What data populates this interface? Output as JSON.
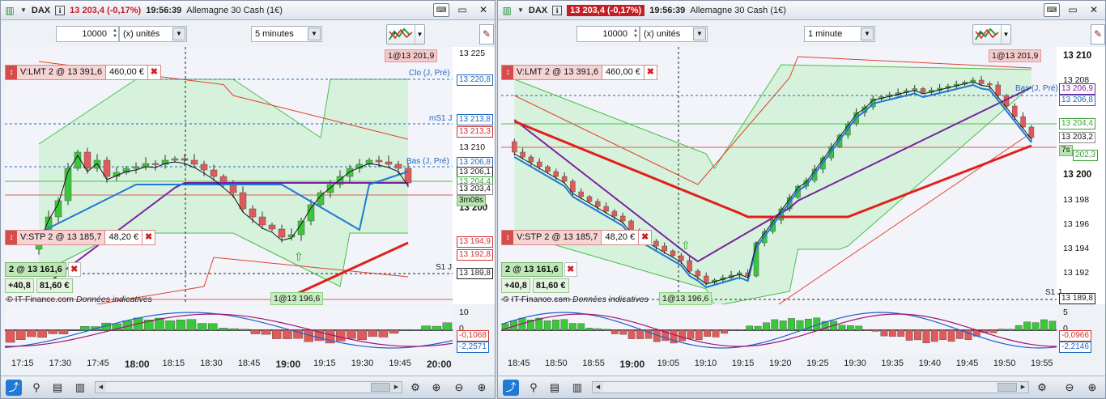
{
  "left": {
    "symbol": "DAX",
    "price": "13 203,4 (-0,17%)",
    "time": "19:56:39",
    "instrument": "Allemagne 30 Cash (1€)",
    "quantity": "10000",
    "unit": "(x) unités",
    "timeframe": "5 minutes",
    "yticks": [
      "13 225",
      "13 210",
      "13 200"
    ],
    "yboxes": {
      "clo": "13 220,8",
      "ms1": "13 213,8",
      "r": "13 213,3",
      "bas": "13 206,8",
      "v1": "13 206,1",
      "v2": "13 204,4",
      "last": "13 203,4",
      "timer": "3m08s",
      "stp": "13 194,9",
      "b2": "13 192,8",
      "s1": "13 189,8"
    },
    "levels": {
      "clo": "Clo (J, Pré)",
      "ms1": "mS1 J",
      "bas": "Bas (J, Pré)",
      "s1": "S1 J"
    },
    "order_lmt": {
      "label": "V:LMT  2 @ 13 391,6",
      "value": "460,00 €"
    },
    "order_stp": {
      "label": "V:STP  2 @ 13 185,7",
      "value": "48,20 €"
    },
    "position": {
      "label": "2 @ 13 161,6",
      "pnl_points": "+40,8",
      "pnl_value": "81,60 €"
    },
    "pill_top": "1@13 201,9",
    "pill_bottom": "1@13 196,6",
    "footer_brand": "IT-Finance.com",
    "footer_note": "Données indicatives",
    "xticks": [
      "17:15",
      "17:30",
      "17:45",
      "18:00",
      "18:15",
      "18:30",
      "18:45",
      "19:00",
      "19:15",
      "19:30",
      "19:45",
      "20:00"
    ],
    "ind_ticks": [
      "10",
      "0"
    ],
    "ind_vals": [
      "-0,1068",
      "-2,2571"
    ]
  },
  "right": {
    "symbol": "DAX",
    "price": "13 203,4 (-0,17%)",
    "time": "19:56:39",
    "instrument": "Allemagne 30 Cash (1€)",
    "quantity": "10000",
    "unit": "(x) unités",
    "timeframe": "1 minute",
    "yticks": [
      "13 210",
      "13 208",
      "13 200",
      "13 198",
      "13 196",
      "13 194",
      "13 192"
    ],
    "yboxes": {
      "bas": "13 206,9",
      "v1": "13 206,8",
      "v2": "13 204,4",
      "last": "13 203,2",
      "timer": "7s",
      "small": "202,3",
      "s1": "13 189,8"
    },
    "levels": {
      "bas": "Bas (J, Pré)",
      "s1": "S1 J"
    },
    "order_lmt": {
      "label": "V:LMT  2 @ 13 391,6",
      "value": "460,00 €"
    },
    "order_stp": {
      "label": "V:STP  2 @ 13 185,7",
      "value": "48,20 €"
    },
    "position": {
      "label": "2 @ 13 161,6",
      "pnl_points": "+40,8",
      "pnl_value": "81,60 €"
    },
    "pill_top": "1@13 201,9",
    "pill_bottom": "1@13 196,6",
    "footer_brand": "IT-Finance.com",
    "footer_note": "Données indicatives",
    "xticks": [
      "18:45",
      "18:50",
      "18:55",
      "19:00",
      "19:05",
      "19:10",
      "19:15",
      "19:20",
      "19:25",
      "19:30",
      "19:35",
      "19:40",
      "19:45",
      "19:50",
      "19:55"
    ],
    "ind_ticks": [
      "5",
      "0"
    ],
    "ind_vals": [
      "-0,0966",
      "-2,2146"
    ]
  },
  "icons": [
    "chart-icon",
    "info-icon",
    "keyboard-icon",
    "minimize-icon",
    "close-icon",
    "indicator-tool-icon",
    "pencil-icon",
    "share-icon",
    "tools-icon",
    "report-icon",
    "columns-icon",
    "zoom-fit-icon",
    "zoom-out-icon",
    "zoom-in-icon"
  ],
  "colors": {
    "up": "#3cc63c",
    "down": "#e05a5a",
    "accent_price": "#c51d22",
    "ma_blue": "#1f78d6",
    "ma_purple": "#7a1fa0",
    "ma_red": "#e0201c"
  }
}
